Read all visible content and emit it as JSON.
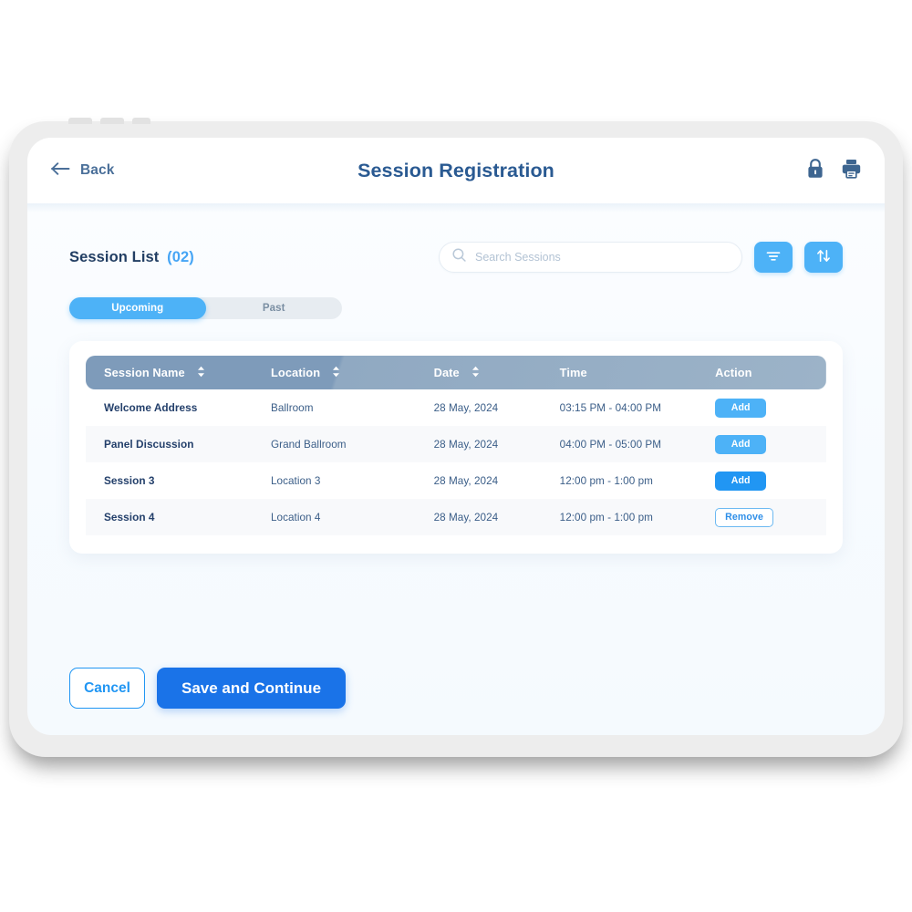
{
  "header": {
    "back_label": "Back",
    "title": "Session Registration",
    "back_icon": "arrow-left-icon",
    "lock_icon": "lock-icon",
    "print_icon": "printer-icon"
  },
  "toolbar": {
    "list_title": "Session List",
    "list_count": "(02)",
    "search_placeholder": "Search Sessions",
    "search_value": "",
    "search_icon": "search-icon",
    "filter_icon": "filter-icon",
    "sort_icon": "sort-arrows-icon"
  },
  "tabs": [
    {
      "label": "Upcoming",
      "active": true
    },
    {
      "label": "Past",
      "active": false
    }
  ],
  "table": {
    "columns": [
      {
        "label": "Session Name",
        "sortable": true
      },
      {
        "label": "Location",
        "sortable": true
      },
      {
        "label": "Date",
        "sortable": true
      },
      {
        "label": "Time",
        "sortable": false
      },
      {
        "label": "Action",
        "sortable": false
      }
    ],
    "rows": [
      {
        "name": "Welcome Address",
        "location": "Ballroom",
        "date": "28 May, 2024",
        "time": "03:15 PM - 04:00 PM",
        "action_label": "Add",
        "action_style": "add"
      },
      {
        "name": "Panel Discussion",
        "location": "Grand Ballroom",
        "date": "28 May, 2024",
        "time": "04:00 PM - 05:00 PM",
        "action_label": "Add",
        "action_style": "add"
      },
      {
        "name": "Session 3",
        "location": "Location 3",
        "date": "28 May, 2024",
        "time": "12:00 pm - 1:00 pm",
        "action_label": "Add",
        "action_style": "add-solid"
      },
      {
        "name": "Session 4",
        "location": "Location 4",
        "date": "28 May, 2024",
        "time": "12:00 pm - 1:00 pm",
        "action_label": "Remove",
        "action_style": "remove"
      }
    ]
  },
  "footer": {
    "cancel_label": "Cancel",
    "save_label": "Save and Continue"
  },
  "colors": {
    "accent_light_blue": "#4db2f7",
    "accent_blue": "#2196f3",
    "primary_blue": "#1a73e8",
    "title_navy": "#2a5a92",
    "table_header_slate": "#7e9bba",
    "text_navy": "#24406b"
  }
}
